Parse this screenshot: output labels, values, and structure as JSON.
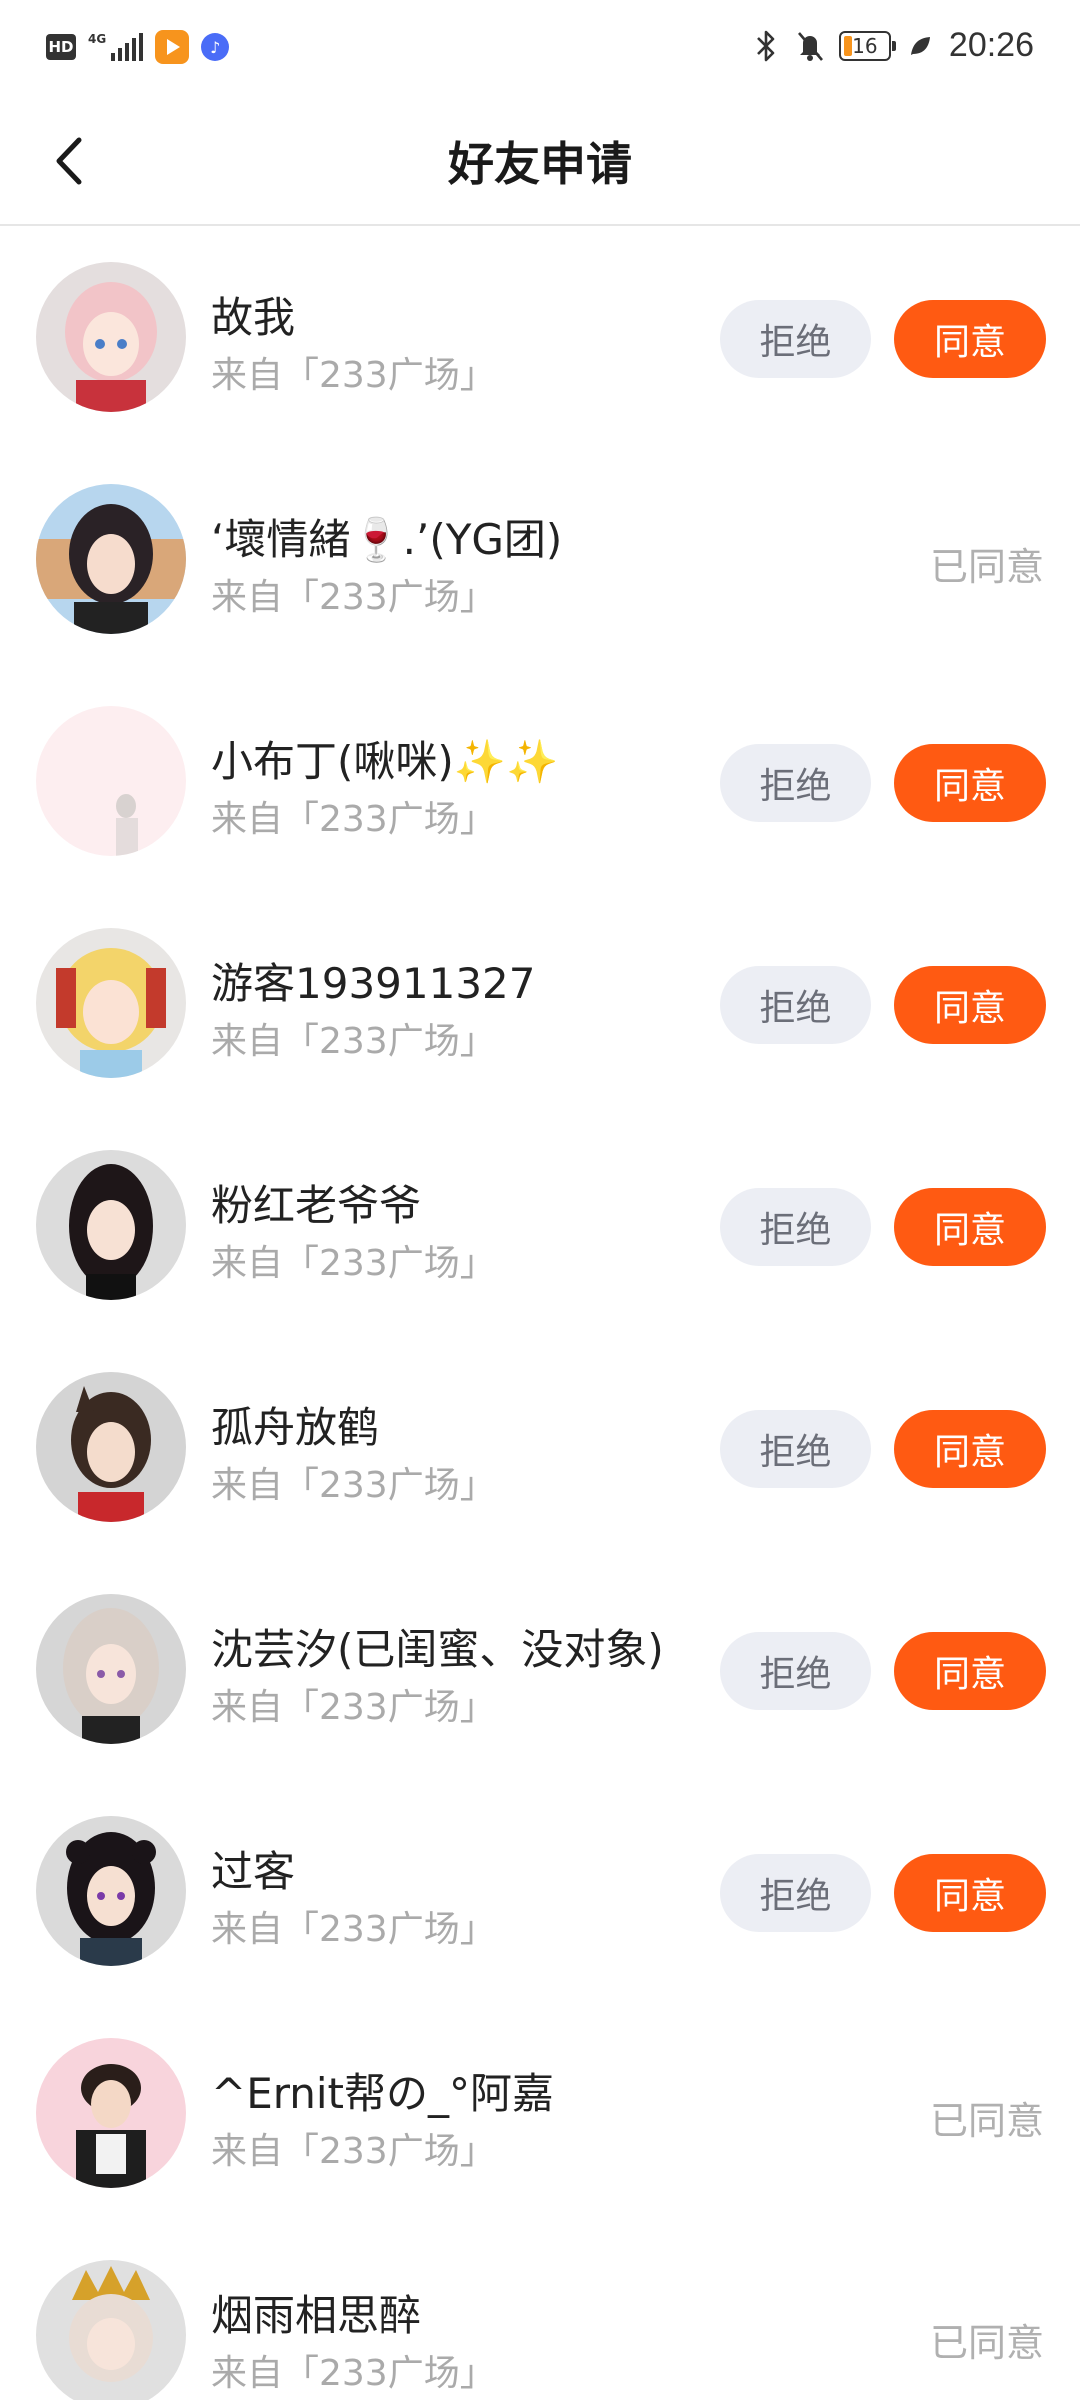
{
  "status_bar": {
    "hd": "HD",
    "network": "4G",
    "battery": "16",
    "time": "20:26"
  },
  "header": {
    "title": "好友申请"
  },
  "colors": {
    "accent": "#ff5a12",
    "reject_bg": "#eceef4",
    "muted_text": "#aaaaaa"
  },
  "requests": [
    {
      "name": "故我",
      "source": "来自「233广场」",
      "status": "pending",
      "reject_label": "拒绝",
      "accept_label": "同意",
      "accepted_label": ""
    },
    {
      "name": "‘壞情緒🍷.’(YG团)",
      "source": "来自「233广场」",
      "status": "accepted",
      "reject_label": "",
      "accept_label": "",
      "accepted_label": "已同意"
    },
    {
      "name": "小布丁(啾咪)✨✨",
      "source": "来自「233广场」",
      "status": "pending",
      "reject_label": "拒绝",
      "accept_label": "同意",
      "accepted_label": ""
    },
    {
      "name": "游客193911327",
      "source": "来自「233广场」",
      "status": "pending",
      "reject_label": "拒绝",
      "accept_label": "同意",
      "accepted_label": ""
    },
    {
      "name": "粉红老爷爷",
      "source": "来自「233广场」",
      "status": "pending",
      "reject_label": "拒绝",
      "accept_label": "同意",
      "accepted_label": ""
    },
    {
      "name": "孤舟放鹤",
      "source": "来自「233广场」",
      "status": "pending",
      "reject_label": "拒绝",
      "accept_label": "同意",
      "accepted_label": ""
    },
    {
      "name": "沈芸汐(已闺蜜、没对象)",
      "source": "来自「233广场」",
      "status": "pending",
      "reject_label": "拒绝",
      "accept_label": "同意",
      "accepted_label": ""
    },
    {
      "name": "过客",
      "source": "来自「233广场」",
      "status": "pending",
      "reject_label": "拒绝",
      "accept_label": "同意",
      "accepted_label": ""
    },
    {
      "name": "^Ernit帮の_°阿嘉",
      "source": "来自「233广场」",
      "status": "accepted",
      "reject_label": "",
      "accept_label": "",
      "accepted_label": "已同意"
    },
    {
      "name": "烟雨相思醉",
      "source": "来自「233广场」",
      "status": "accepted",
      "reject_label": "",
      "accept_label": "",
      "accepted_label": "已同意"
    }
  ]
}
